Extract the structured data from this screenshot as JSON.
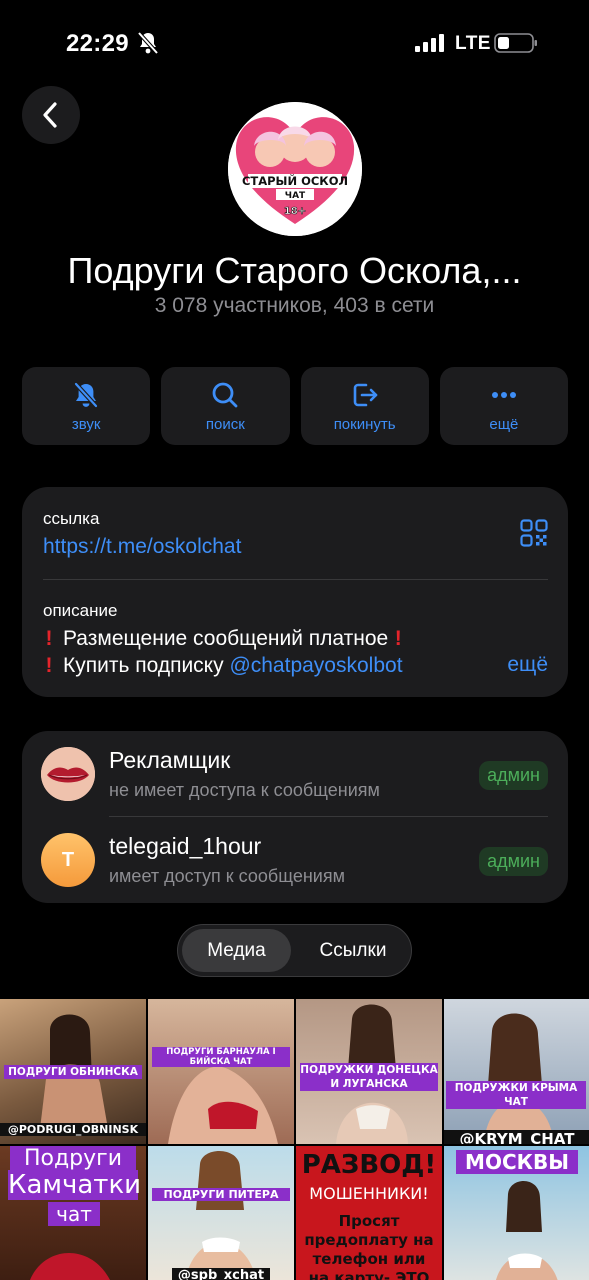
{
  "status": {
    "time": "22:29",
    "network": "LTE"
  },
  "chat": {
    "avatar_text_line1": "СТАРЫЙ ОСКОЛ",
    "avatar_text_line2": "ЧАТ",
    "avatar_text_line3": "18+",
    "title": "Подруги Старого Оскола,...",
    "subtitle": "3 078 участников, 403 в сети"
  },
  "actions": [
    {
      "label": "звук",
      "icon": "bell-off-icon"
    },
    {
      "label": "поиск",
      "icon": "search-icon"
    },
    {
      "label": "покинуть",
      "icon": "leave-icon"
    },
    {
      "label": "ещё",
      "icon": "more-icon"
    }
  ],
  "info": {
    "link_label": "ссылка",
    "link": "https://t.me/oskolchat",
    "description_label": "описание",
    "description_line1": "Размещение сообщений платное",
    "description_line2_prefix": "Купить подписку ",
    "description_mention": "@chatpayoskolbot",
    "more": "ещё"
  },
  "admins": [
    {
      "name": "Рекламщик",
      "status": "не имеет доступа к сообщениям",
      "badge": "админ"
    },
    {
      "name": "telegaid_1hour",
      "status": "имеет доступ к сообщениям",
      "badge": "админ",
      "initial": "T"
    }
  ],
  "tabs": {
    "media": "Медиа",
    "links": "Ссылки"
  },
  "media": [
    {
      "caption_top": "ПОДРУГИ ОБНИНСКА",
      "caption_bottom": "@PODRUGI_OBNINSK"
    },
    {
      "caption_top": "ПОДРУГИ БАРНАУЛА І БИЙСКА ЧАТ"
    },
    {
      "caption_top": "ПОДРУЖКИ ДОНЕЦКА И ЛУГАНСКА"
    },
    {
      "caption_top": "ПОДРУЖКИ КРЫМА ЧАТ",
      "caption_bottom": "@KRYM_CHAT"
    },
    {
      "caption_top": "Подруги",
      "caption_mid": "Камчатки",
      "caption_bottom": "чат"
    },
    {
      "caption_top": "ПОДРУГИ ПИТЕРА",
      "caption_bottom": "@spb_xchat"
    },
    {
      "caption_top": "РАЗВОД!",
      "caption_mid": "МОШЕННИКИ!",
      "caption_bottom": "Просят предоплату на телефон или на карту- ЭТО"
    },
    {
      "caption_top": "МОСКВЫ"
    }
  ],
  "colors": {
    "accent": "#3e8ef7",
    "card": "#1c1c1e",
    "admin_badge": "#4cae5a",
    "alert": "#e5242b"
  }
}
